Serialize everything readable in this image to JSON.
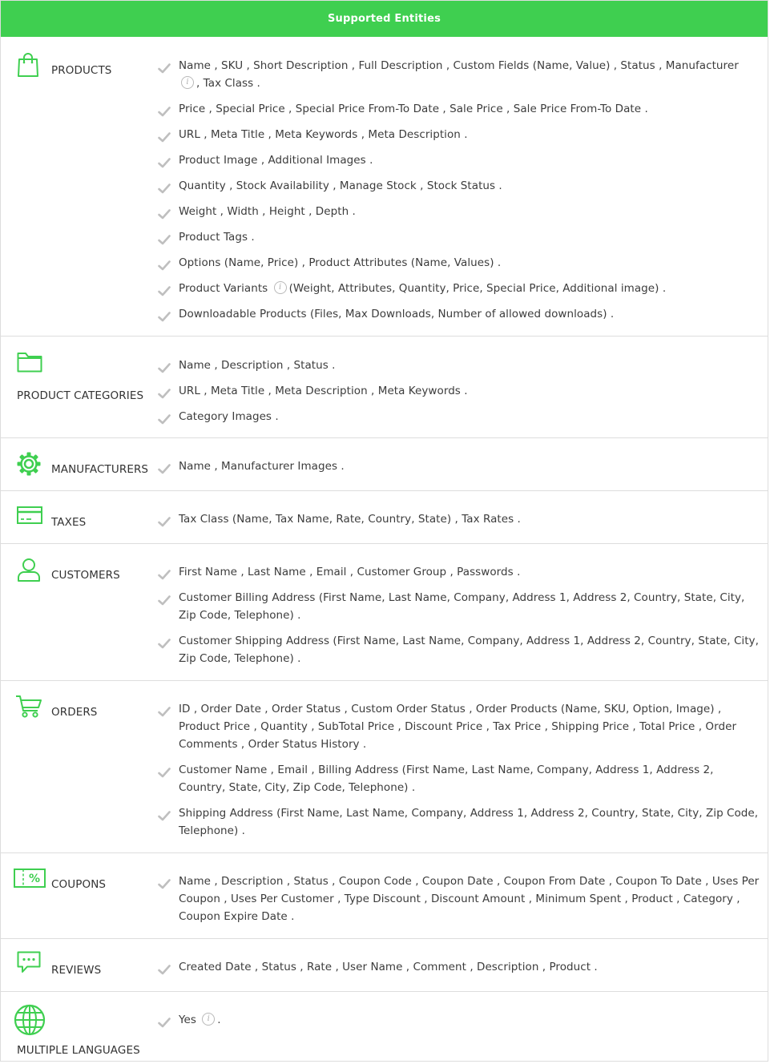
{
  "header": {
    "title": "Supported Entities"
  },
  "colors": {
    "accent": "#3fcf50",
    "check": "#bfbfbf",
    "icon": "#3fcf50"
  },
  "rows": [
    {
      "name": "PRODUCTS",
      "icon": "shopping-bag-icon",
      "features": [
        "Name , SKU , Short Description , Full Description , Custom Fields (Name, Value) , Status , Manufacturer",
        "Price , Special Price , Special Price From-To Date , Sale Price , Sale Price From-To Date .",
        "URL , Meta Title , Meta Keywords , Meta Description .",
        "Product Image , Additional Images .",
        "Quantity , Stock Availability , Manage Stock , Stock Status .",
        "Weight , Width , Height , Depth .",
        "Product Tags .",
        "Options (Name, Price) , Product Attributes (Name, Values) .",
        "Product Variants",
        "Downloadable Products (Files, Max Downloads, Number of allowed downloads) ."
      ],
      "feature_suffixes": {
        "0": ", Tax Class .",
        "8": "(Weight, Attributes, Quantity, Price, Special Price, Additional image) ."
      }
    },
    {
      "name": "PRODUCT CATEGORIES",
      "icon": "folder-icon",
      "features": [
        "Name , Description , Status .",
        "URL , Meta Title , Meta Description , Meta Keywords .",
        "Category Images ."
      ]
    },
    {
      "name": "MANUFACTURERS",
      "icon": "gear-icon",
      "features": [
        "Name , Manufacturer Images ."
      ]
    },
    {
      "name": "TAXES",
      "icon": "credit-card-icon",
      "features": [
        "Tax Class (Name, Tax Name, Rate, Country, State) , Tax Rates ."
      ]
    },
    {
      "name": "CUSTOMERS",
      "icon": "user-icon",
      "features": [
        "First Name , Last Name , Email , Customer Group , Passwords .",
        "Customer Billing Address (First Name, Last Name, Company, Address 1, Address 2, Country, State, City, Zip Code, Telephone) .",
        "Customer Shipping Address (First Name, Last Name, Company, Address 1, Address 2, Country, State, City, Zip Code, Telephone) ."
      ]
    },
    {
      "name": "ORDERS",
      "icon": "cart-icon",
      "features": [
        "ID , Order Date , Order Status , Custom Order Status , Order Products (Name, SKU, Option, Image) , Product Price , Quantity , SubTotal Price , Discount Price , Tax Price , Shipping Price , Total Price , Order Comments , Order Status History .",
        "Customer Name , Email , Billing Address (First Name, Last Name, Company, Address 1, Address 2, Country, State, City, Zip Code, Telephone) .",
        "Shipping Address (First Name, Last Name, Company, Address 1, Address 2, Country, State, City, Zip Code, Telephone) ."
      ]
    },
    {
      "name": "COUPONS",
      "icon": "coupon-icon",
      "features": [
        "Name , Description , Status , Coupon Code , Coupon Date , Coupon From Date , Coupon To Date , Uses Per Coupon , Uses Per Customer , Type Discount , Discount Amount , Minimum Spent , Product , Category , Coupon Expire Date ."
      ]
    },
    {
      "name": "REVIEWS",
      "icon": "chat-icon",
      "features": [
        "Created Date , Status , Rate , User Name , Comment , Description , Product ."
      ]
    },
    {
      "name": "MULTIPLE LANGUAGES",
      "icon": "globe-icon",
      "features": [
        "Yes"
      ],
      "feature_suffixes": {
        "0": "."
      }
    }
  ]
}
